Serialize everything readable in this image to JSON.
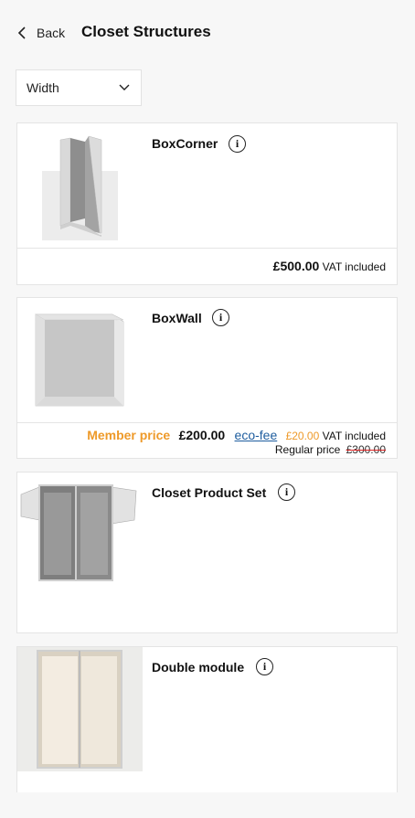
{
  "header": {
    "back_label": "Back",
    "title": "Closet Structures"
  },
  "filter": {
    "label": "Width"
  },
  "products": [
    {
      "name": "BoxCorner",
      "price": "£500.00",
      "vat": "VAT included"
    },
    {
      "name": "BoxWall",
      "member_label": "Member price",
      "price": "£200.00",
      "ecofee_label": "eco-fee",
      "ecofee_amount": "£20.00",
      "vat": "VAT included",
      "regular_label": "Regular price",
      "regular_price": "£300.00"
    },
    {
      "name": "Closet Product Set"
    },
    {
      "name": "Double module"
    }
  ],
  "colors": {
    "member": "#ee9a2a",
    "ecofee_link": "#1d5c9e",
    "strike": "#dd2222"
  },
  "icons": [
    "chevron-left-icon",
    "chevron-down-icon",
    "info-icon"
  ]
}
